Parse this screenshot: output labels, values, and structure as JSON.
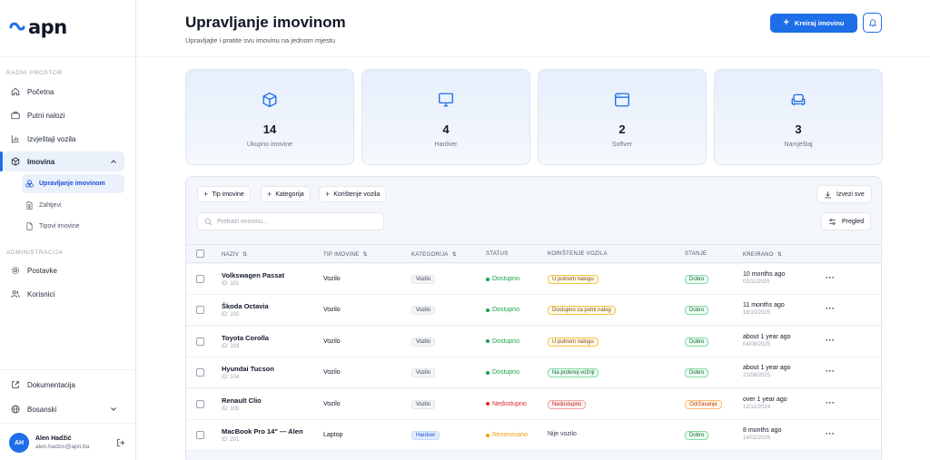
{
  "brand": {
    "name": "apn"
  },
  "sidebar": {
    "section_workspace": "RADNI PROSTOR",
    "section_admin": "ADMINISTRACIJA",
    "items": [
      {
        "label": "Početna",
        "icon": "home-icon"
      },
      {
        "label": "Putni nalozi",
        "icon": "briefcase-icon"
      },
      {
        "label": "Izvještaji vozila",
        "icon": "chart-icon"
      },
      {
        "label": "Imovina",
        "icon": "box-icon"
      }
    ],
    "sub_items": [
      {
        "label": "Upravljanje imovinom",
        "icon": "boxes-icon"
      },
      {
        "label": "Zahtjevi",
        "icon": "document-icon"
      },
      {
        "label": "Tipovi imovine",
        "icon": "file-icon"
      }
    ],
    "admin_items": [
      {
        "label": "Postavke",
        "icon": "gear-icon"
      },
      {
        "label": "Korisnici",
        "icon": "users-icon"
      }
    ],
    "docs_label": "Dokumentacija",
    "language_label": "Bosanski",
    "user": {
      "initials": "AH",
      "name": "Alen Hadžić",
      "email": "alen.hadzic@apn.ba"
    }
  },
  "header": {
    "title": "Upravljanje imovinom",
    "subtitle": "Upravljajte i pratite svu imovinu na jednom mjestu",
    "create_label": "Kreiraj imovinu"
  },
  "stats": [
    {
      "value": "14",
      "label": "Ukupno imovine",
      "icon": "cube-icon"
    },
    {
      "value": "4",
      "label": "Hardver",
      "icon": "monitor-icon"
    },
    {
      "value": "2",
      "label": "Softver",
      "icon": "window-icon"
    },
    {
      "value": "3",
      "label": "Namještaj",
      "icon": "sofa-icon"
    }
  ],
  "toolbar": {
    "filter_type": "Tip imovine",
    "filter_category": "Kategorija",
    "filter_usage": "Korištenje vozila",
    "export_label": "Izvezi sve",
    "search_placeholder": "Pretraži imovinu...",
    "view_label": "Pregled"
  },
  "table": {
    "columns": [
      "NAZIV",
      "TIP IMOVINE",
      "KATEGORIJA",
      "STATUS",
      "KORIŠTENJE VOZILA",
      "STANJE",
      "KREIRANO"
    ],
    "rows": [
      {
        "name": "Volkswagen Passat",
        "id": "ID: 101",
        "type": "Vozilo",
        "category": "Vozilo",
        "status": "Dostupno",
        "status_color": "#16a34a",
        "usage": "U putnom nalogu",
        "usage_style": "yellow",
        "condition": "Dobro",
        "condition_style": "green",
        "created": "10 months ago",
        "created_date": "02/11/2025"
      },
      {
        "name": "Škoda Octavia",
        "id": "ID: 102",
        "type": "Vozilo",
        "category": "Vozilo",
        "status": "Dostupno",
        "status_color": "#16a34a",
        "usage": "Dostupno za putni nalog",
        "usage_style": "yellow",
        "condition": "Dobro",
        "condition_style": "green",
        "created": "11 months ago",
        "created_date": "18/10/2025"
      },
      {
        "name": "Toyota Corolla",
        "id": "ID: 103",
        "type": "Vozilo",
        "category": "Vozilo",
        "status": "Dostupno",
        "status_color": "#16a34a",
        "usage": "U putnom nalogu",
        "usage_style": "yellow",
        "condition": "Dobro",
        "condition_style": "green",
        "created": "about 1 year ago",
        "created_date": "04/09/2025"
      },
      {
        "name": "Hyundai Tucson",
        "id": "ID: 104",
        "type": "Vozilo",
        "category": "Vozilo",
        "status": "Dostupno",
        "status_color": "#16a34a",
        "usage": "Na probnoj vožnji",
        "usage_style": "green",
        "condition": "Dobro",
        "condition_style": "green",
        "created": "about 1 year ago",
        "created_date": "21/08/2025"
      },
      {
        "name": "Renault Clio",
        "id": "ID: 105",
        "type": "Vozilo",
        "category": "Vozilo",
        "status": "Nedostupno",
        "status_color": "#dc2626",
        "usage": "Nedostupno",
        "usage_style": "red",
        "condition": "Održavanje",
        "condition_style": "orange",
        "created": "over 1 year ago",
        "created_date": "12/12/2024"
      },
      {
        "name": "MacBook Pro 14\" — Alen",
        "id": "ID: 201",
        "type": "Laptop",
        "category": "Hardver",
        "category_style": "blue",
        "status": "Rezervisano",
        "status_color": "#f59e0b",
        "usage": "Nije vozilo",
        "usage_style": "plain",
        "condition": "Dobro",
        "condition_style": "green",
        "created": "8 months ago",
        "created_date": "14/01/2026"
      }
    ]
  },
  "colors": {
    "accent": "#1e6ee8",
    "active_bg": "#eaf1fb"
  }
}
